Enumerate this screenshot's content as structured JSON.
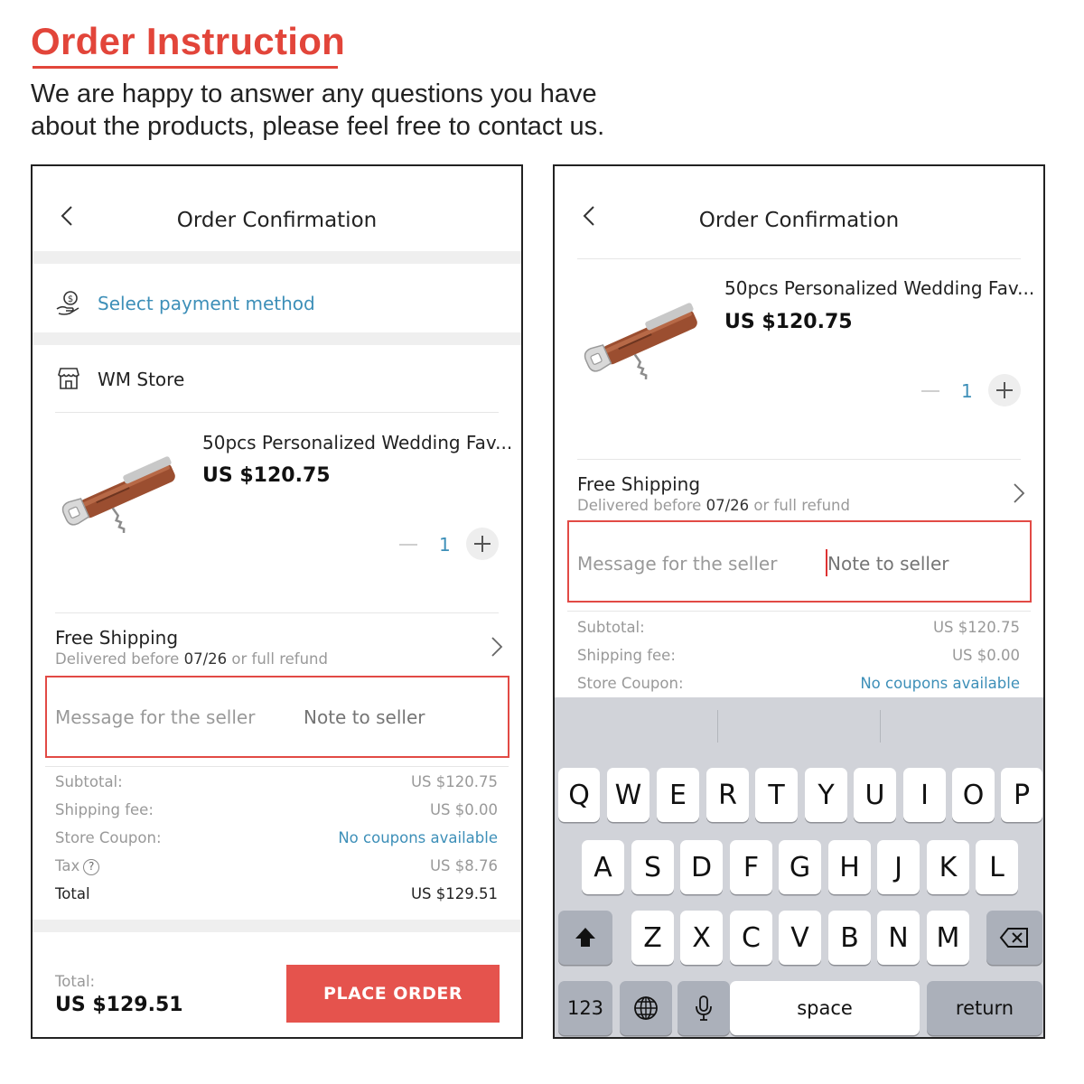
{
  "header": {
    "title": "Order Instruction",
    "intro_line1": "We are happy to answer any questions you have",
    "intro_line2": "about the products, please feel free to contact us."
  },
  "left_screen": {
    "title": "Order Confirmation",
    "payment_label": "Select payment method",
    "store_name": "WM Store",
    "product": {
      "title": "50pcs Personalized Wedding Fav...",
      "price": "US $120.75",
      "quantity": "1"
    },
    "shipping": {
      "title": "Free Shipping",
      "sub_prefix": "Delivered before ",
      "sub_date": "07/26",
      "sub_suffix": " or full refund"
    },
    "message": {
      "label": "Message for the seller",
      "placeholder": "Note to seller"
    },
    "summary": {
      "subtotal_label": "Subtotal:",
      "subtotal_value": "US $120.75",
      "shipping_label": "Shipping fee:",
      "shipping_value": "US $0.00",
      "coupon_label": "Store Coupon:",
      "coupon_value": "No coupons available",
      "tax_label": "Tax",
      "tax_value": "US $8.76",
      "total_label": "Total",
      "total_value": "US $129.51"
    },
    "footer": {
      "total_label": "Total:",
      "total_value": "US $129.51",
      "place_order": "PLACE ORDER"
    }
  },
  "right_screen": {
    "title": "Order Confirmation",
    "product": {
      "title": "50pcs Personalized Wedding Fav...",
      "price": "US $120.75",
      "quantity": "1"
    },
    "shipping": {
      "title": "Free Shipping",
      "sub_prefix": "Delivered before ",
      "sub_date": "07/26",
      "sub_suffix": " or full refund"
    },
    "message": {
      "label": "Message for the seller",
      "placeholder": "Note to seller"
    },
    "summary": {
      "subtotal_label": "Subtotal:",
      "subtotal_value": "US $120.75",
      "shipping_label": "Shipping fee:",
      "shipping_value": "US $0.00",
      "coupon_label": "Store Coupon:",
      "coupon_value": "No coupons available"
    },
    "keyboard": {
      "row1": [
        "Q",
        "W",
        "E",
        "R",
        "T",
        "Y",
        "U",
        "I",
        "O",
        "P"
      ],
      "row2": [
        "A",
        "S",
        "D",
        "F",
        "G",
        "H",
        "J",
        "K",
        "L"
      ],
      "row3": [
        "Z",
        "X",
        "C",
        "V",
        "B",
        "N",
        "M"
      ],
      "numbers_key": "123",
      "space_key": "space",
      "return_key": "return"
    }
  },
  "colors": {
    "accent_red": "#e2453a",
    "link_blue": "#3d8fb8",
    "button_red": "#e5534d"
  }
}
